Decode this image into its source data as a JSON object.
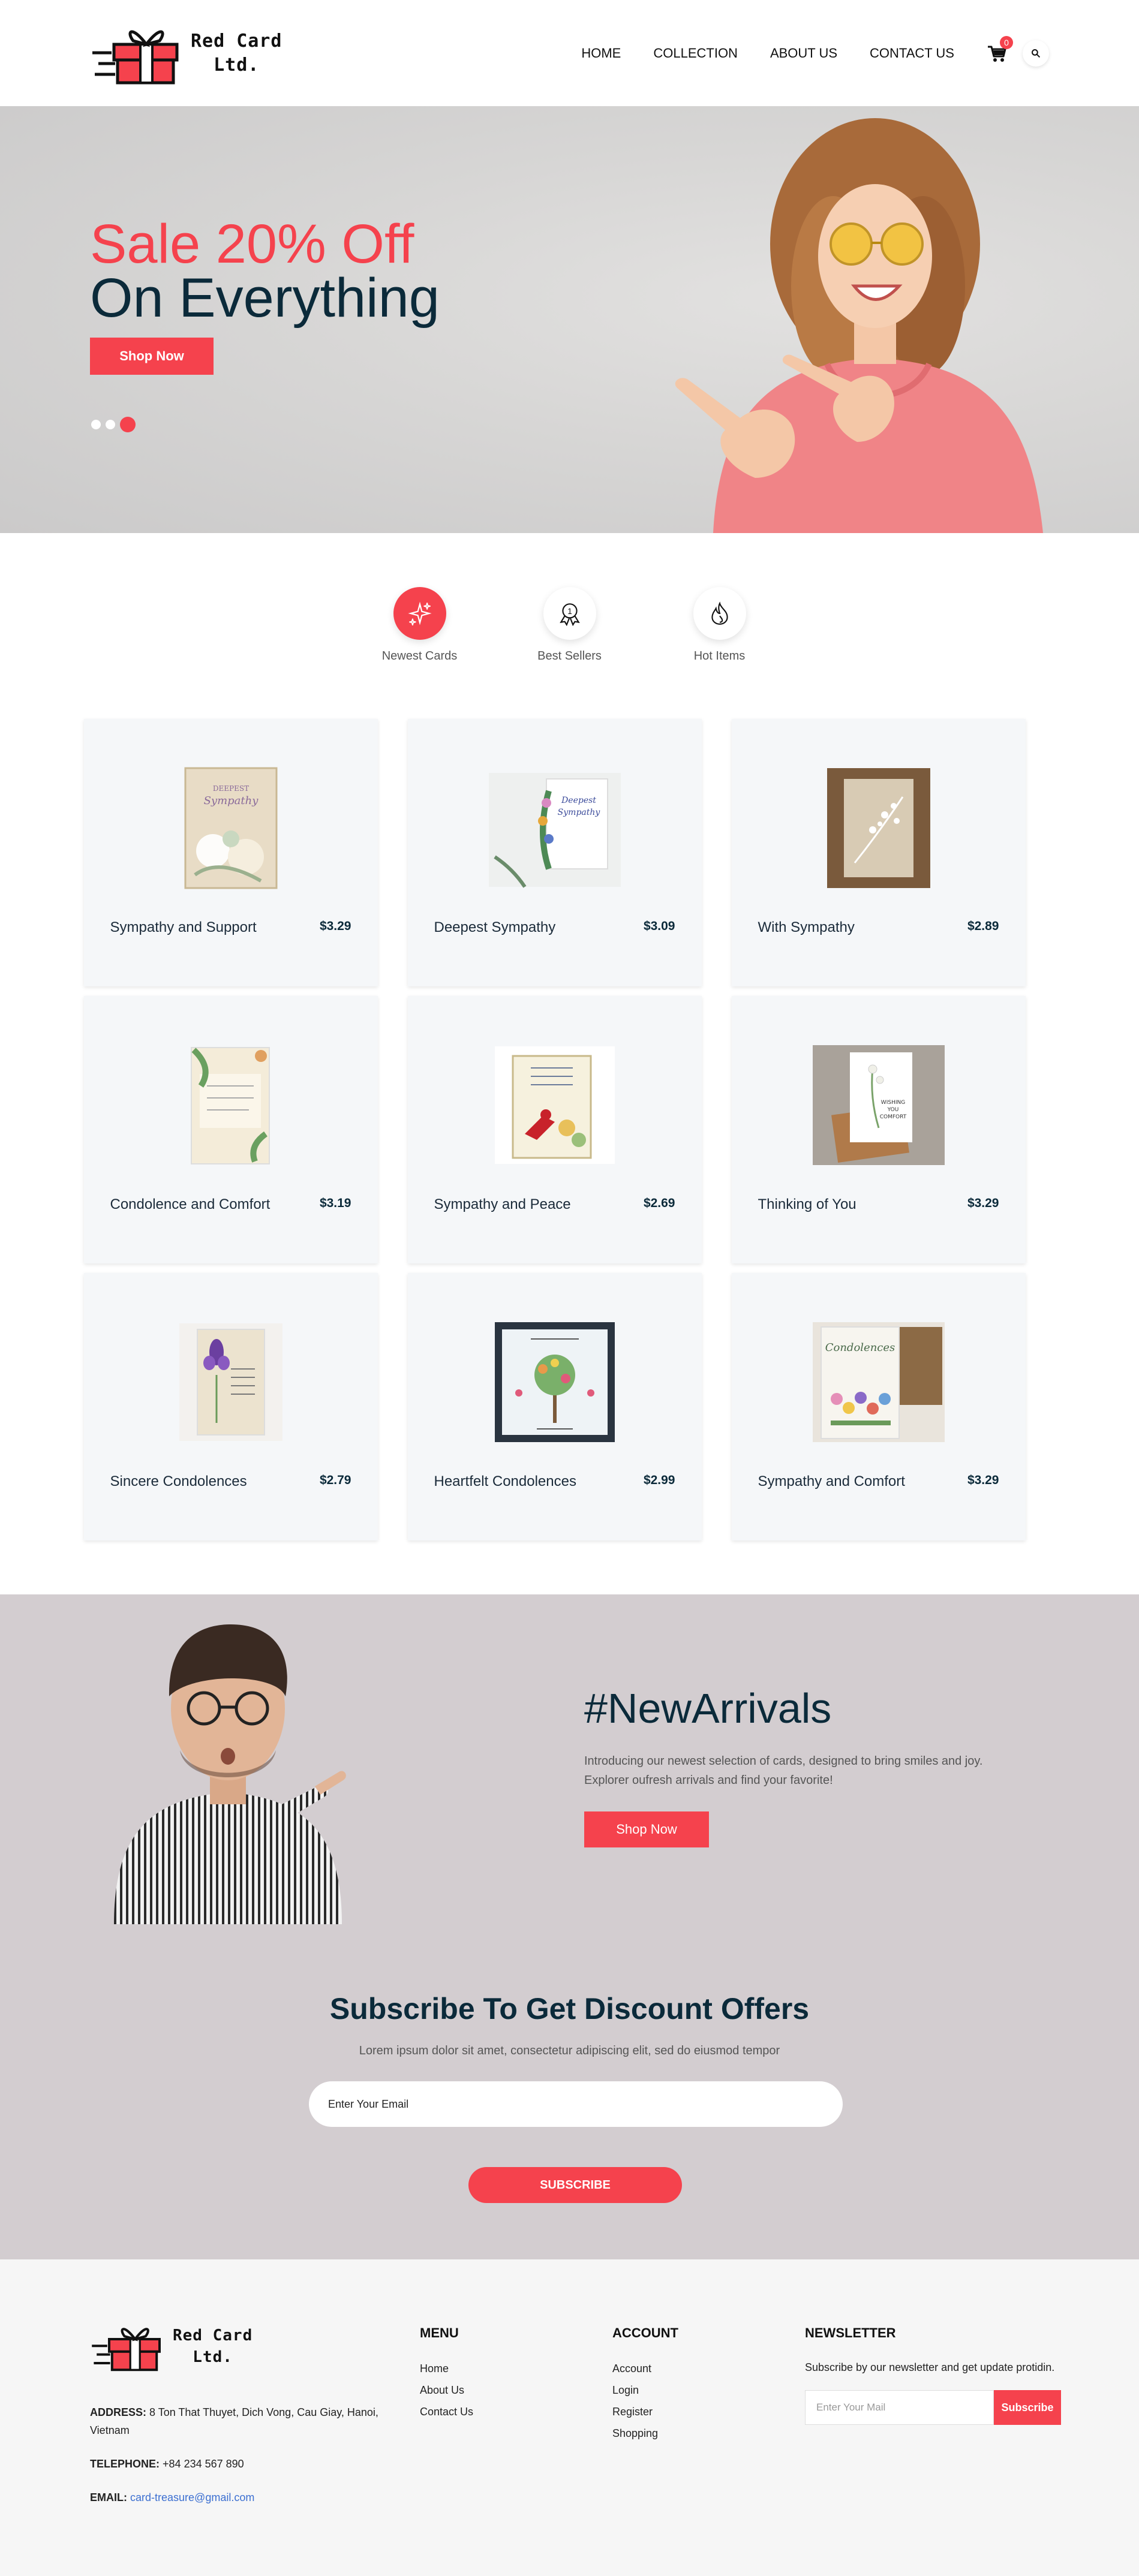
{
  "header": {
    "brand": [
      "Red Card",
      "Ltd."
    ],
    "nav": [
      "HOME",
      "COLLECTION",
      "ABOUT US",
      "CONTACT US"
    ],
    "cart_count": "0"
  },
  "hero": {
    "line1": "Sale 20% Off",
    "line2": "On Everything",
    "button": "Shop Now",
    "slides": 3,
    "active_slide": 3
  },
  "tabs": [
    "Newest Cards",
    "Best Sellers",
    "Hot Items"
  ],
  "products": [
    {
      "name": "Sympathy and Support",
      "price": "$3.29"
    },
    {
      "name": "Deepest Sympathy",
      "price": "$3.09"
    },
    {
      "name": "With Sympathy",
      "price": "$2.89"
    },
    {
      "name": "Condolence and Comfort",
      "price": "$3.19"
    },
    {
      "name": "Sympathy and Peace",
      "price": "$2.69"
    },
    {
      "name": "Thinking of You",
      "price": "$3.29"
    },
    {
      "name": "Sincere Condolences",
      "price": "$2.79"
    },
    {
      "name": "Heartfelt Condolences",
      "price": "$2.99"
    },
    {
      "name": "Sympathy and Comfort",
      "price": "$3.29"
    }
  ],
  "arrivals": {
    "title": "#NewArrivals",
    "text": "Introducing our newest selection of cards, designed to bring smiles and joy. Explorer oufresh arrivals and find your favorite!",
    "button": "Shop Now"
  },
  "subscribe": {
    "title": "Subscribe To Get Discount Offers",
    "text": "Lorem ipsum dolor sit amet, consectetur adipiscing elit, sed do eiusmod tempor",
    "placeholder": "Enter Your Email",
    "button": "SUBSCRIBE"
  },
  "footer": {
    "brand": [
      "Red Card",
      "Ltd."
    ],
    "address_label": "ADDRESS:",
    "address": "8 Ton That Thuyet, Dich Vong, Cau Giay, Hanoi, Vietnam",
    "phone_label": "TELEPHONE:",
    "phone": "+84 234 567 890",
    "email_label": "EMAIL:",
    "email": "card-treasure@gmail.com",
    "menu_title": "MENU",
    "menu": [
      "Home",
      "About Us",
      "Contact Us"
    ],
    "account_title": "ACCOUNT",
    "account": [
      "Account",
      "Login",
      "Register",
      "Shopping"
    ],
    "newsletter_title": "NEWSLETTER",
    "newsletter_text": "Subscribe by our newsletter and get update protidin.",
    "newsletter_placeholder": "Enter Your Mail",
    "newsletter_button": "Subscribe"
  },
  "colors": {
    "accent": "#f5424d",
    "dark": "#0b2a3a",
    "promo_bg": "#d3cdd0",
    "card_bg": "#f5f7f9"
  }
}
